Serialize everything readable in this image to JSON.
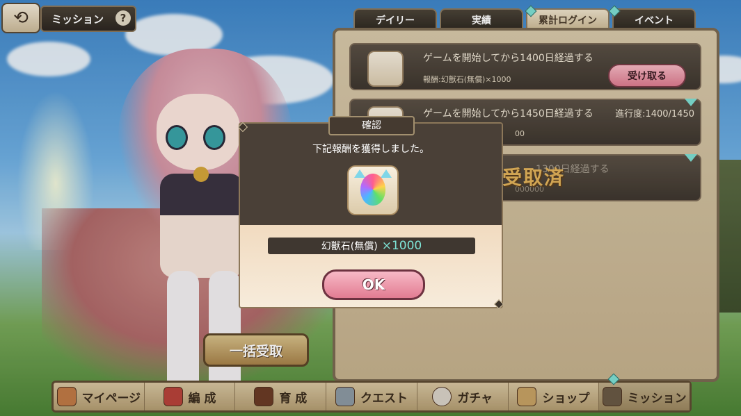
{
  "header": {
    "title": "ミッション",
    "help_icon": "?"
  },
  "tabs": [
    {
      "label": "デイリー",
      "active": false
    },
    {
      "label": "実績",
      "active": false
    },
    {
      "label": "累計ログイン",
      "active": true
    },
    {
      "label": "イベント",
      "active": false
    }
  ],
  "missions": [
    {
      "title": "ゲームを開始してから1400日経過する",
      "reward": "報酬:幻獣石(無償)×1000",
      "button": "受け取る"
    },
    {
      "title": "ゲームを開始してから1450日経過する",
      "reward": "00",
      "progress": "進行度:1400/1450"
    },
    {
      "title": "1300日経過する",
      "reward": "000000",
      "status": "受取済"
    }
  ],
  "bulk_button": "一括受取",
  "dialog": {
    "title": "確認",
    "message": "下記報酬を獲得しました。",
    "reward_name": "幻獣石(無償)",
    "reward_qty": "×1000",
    "ok_label": "OK"
  },
  "nav": [
    {
      "label": "マイページ",
      "icon": "mushroom-house-icon"
    },
    {
      "label": "編 成",
      "icon": "flag-icon"
    },
    {
      "label": "育 成",
      "icon": "book-icon"
    },
    {
      "label": "クエスト",
      "icon": "crossed-swords-icon"
    },
    {
      "label": "ガチャ",
      "icon": "egg-icon"
    },
    {
      "label": "ショップ",
      "icon": "bag-icon"
    },
    {
      "label": "ミッション",
      "icon": "scroll-icon"
    }
  ],
  "colors": {
    "accent": "#7fe6d8",
    "pink_button": "#e27c92",
    "panel": "#c6b28e"
  }
}
